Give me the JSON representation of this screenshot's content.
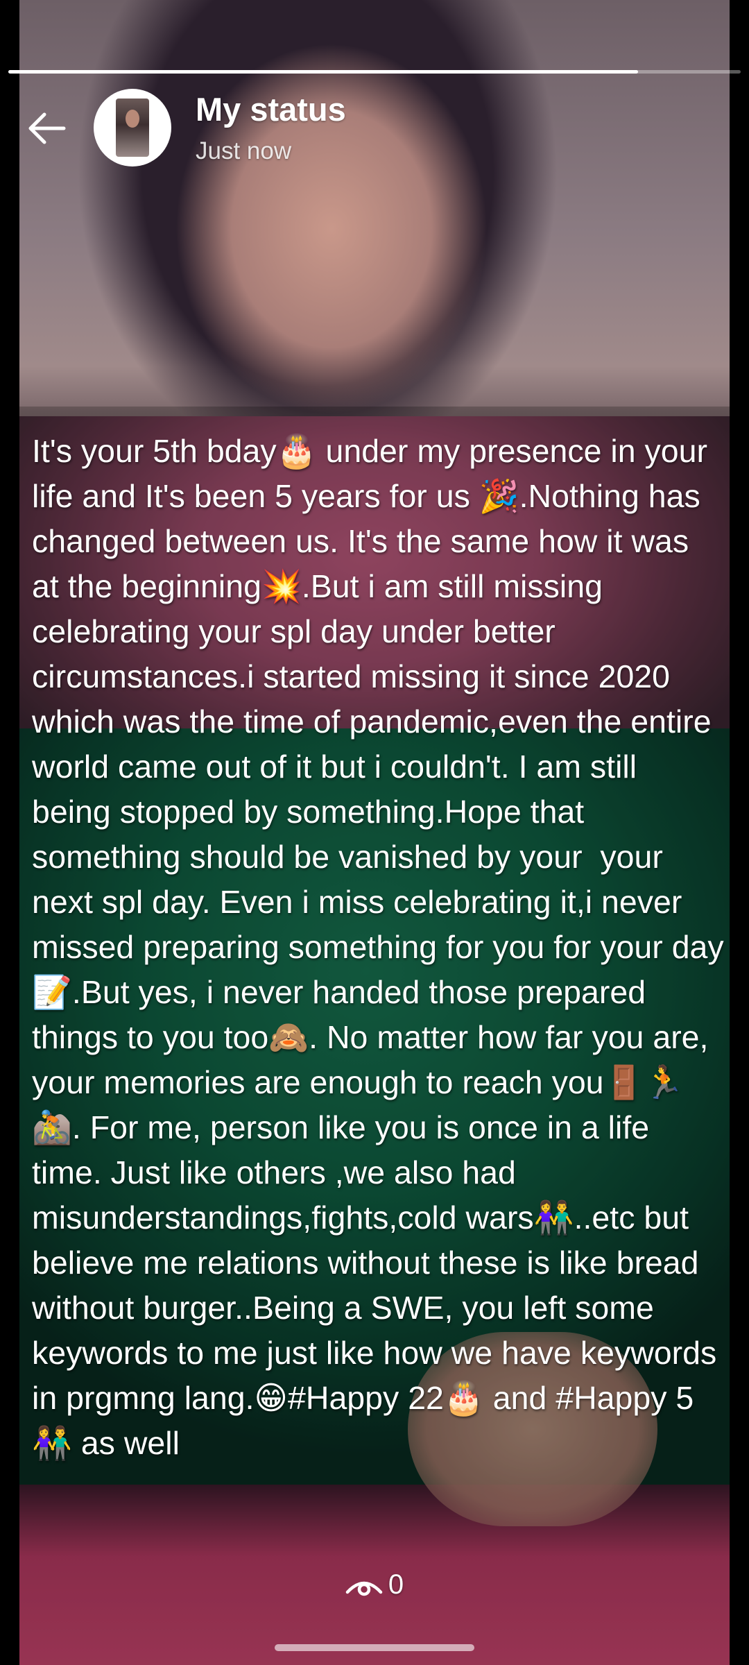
{
  "status": {
    "progress": 0.86,
    "title": "My status",
    "timestamp": "Just now",
    "caption": "It's your 5th bday🎂 under my presence in your life and It's been 5 years for us 🎉.Nothing has changed between us. It's the same how it was at the beginning💥.But i am still missing celebrating your spl day under better circumstances.i started missing it since 2020 which was the time of pandemic,even the entire world came out of it but i couldn't. I am still being stopped by something.Hope that something should be vanished by your  your next spl day. Even i miss celebrating it,i never missed preparing something for you for your day📝.But yes, i never handed those prepared things to you too🙈. No matter how far you are, your memories are enough to reach you🚪🏃🚵. For me, person like you is once in a life time. Just like others ,we also had misunderstandings,fights,cold wars👫..etc but believe me relations without these is like bread without burger..Being a SWE, you left some keywords to me just like how we have keywords in prgmng lang.😁#Happy 22🎂 and #Happy 5👫 as well",
    "views": "0"
  },
  "icons": {
    "back": "arrow-left-icon",
    "views": "eye-icon"
  },
  "colors": {
    "text": "#ffffff",
    "progress_track": "rgba(255,255,255,0.35)"
  }
}
